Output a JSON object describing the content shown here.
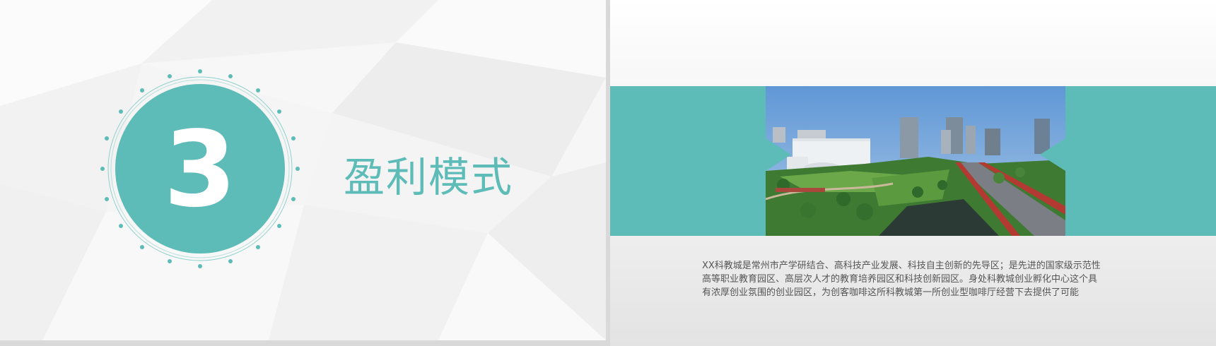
{
  "left_slide": {
    "section_number": "3",
    "section_title": "盈利模式",
    "accent_color": "#5dbcb8"
  },
  "right_slide": {
    "accent_color": "#5dbcb8",
    "photo": "science-education-city-aerial-photo",
    "description_lines": [
      "XX科教城是常州市产学研结合、高科技产业发展、科技自主创新的先导区；是先进的国家级示范性",
      "高等职业教育园区、高层次人才的教育培养园区和科技创新园区。身处科教城创业孵化中心这个具",
      "有浓厚创业氛围的创业园区，为创客咖啡这所科教城第一所创业型咖啡厅经营下去提供了可能"
    ]
  }
}
